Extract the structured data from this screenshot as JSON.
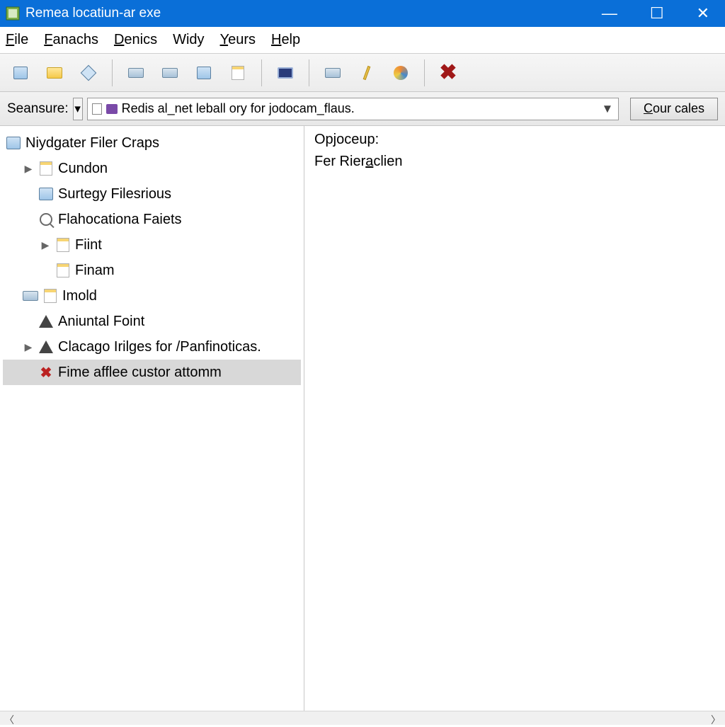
{
  "window": {
    "title": "Remea locatiun-ar exe"
  },
  "menu": {
    "file": "File",
    "file_u": "F",
    "fanachs": "Fanachs",
    "fanachs_u": "F",
    "denics": "Denics",
    "denics_u": "D",
    "widy": "Widy",
    "yeurs": "Yeurs",
    "yeurs_u": "Y",
    "help": "Help",
    "help_u": "H"
  },
  "addr": {
    "label": "Seansure:",
    "value": "Redis al_net leball ory for jodocam_flaus.",
    "go": "Cour cales",
    "go_u": "C"
  },
  "tree": {
    "root": "Niydgater Filer Craps",
    "items": [
      "Cundon",
      "Surtegy Filesrious",
      "Flahocationa Faiets",
      "Fiint",
      "Finam",
      "Imold",
      "Aniuntal Foint",
      "Clacago Irilges for /Panfinoticas.",
      "Fime afflee custor attomm"
    ]
  },
  "detail": {
    "label": "Opjoceup:",
    "value_pre": "Fer Rier",
    "value_u": "a",
    "value_post": "clien"
  }
}
